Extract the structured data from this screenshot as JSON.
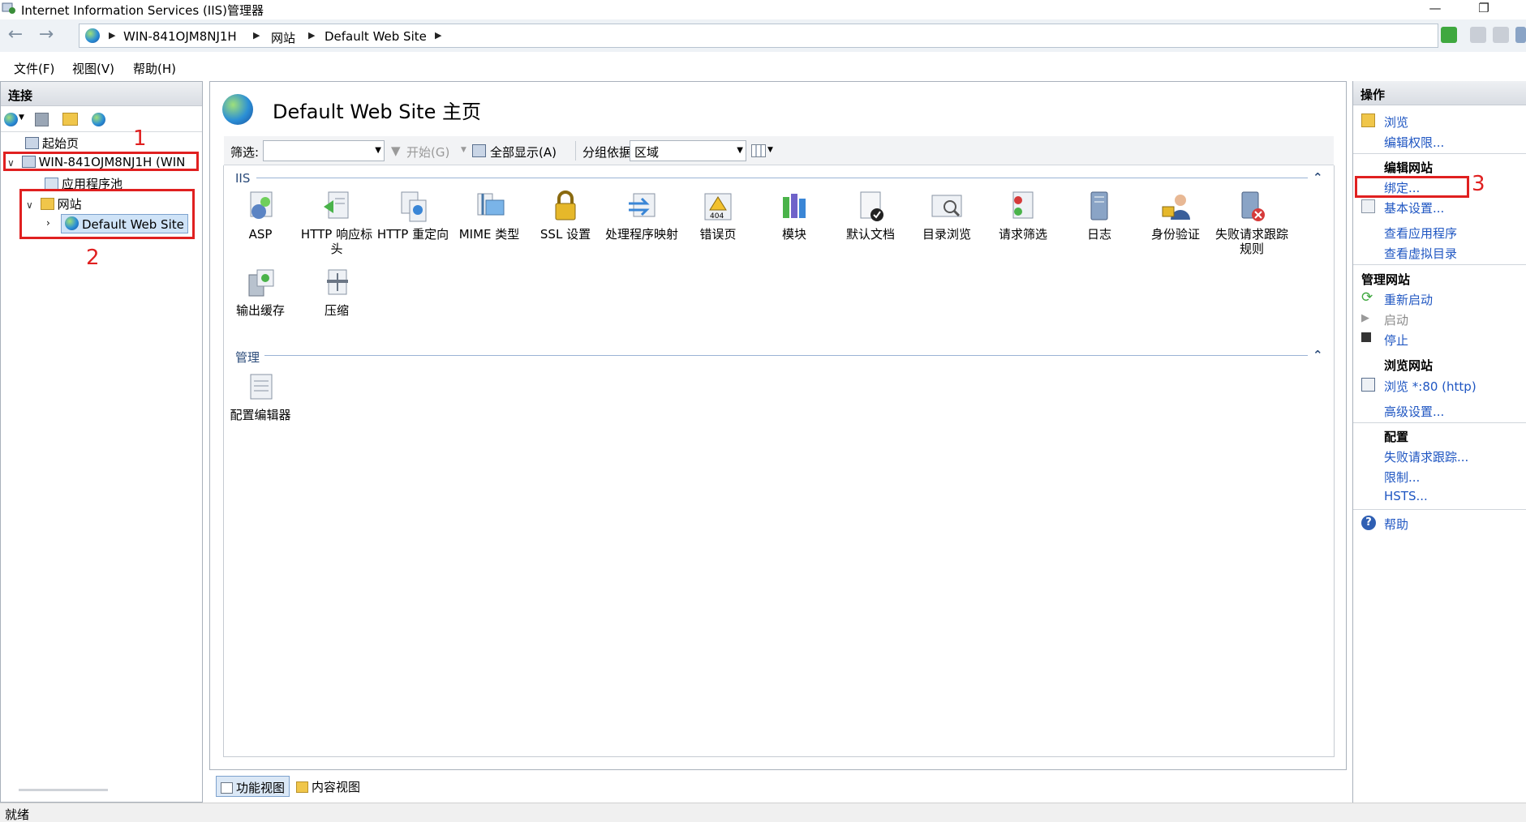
{
  "window": {
    "title": "Internet Information Services (IIS)管理器",
    "minimize": "—",
    "restore": "❐"
  },
  "nav": {
    "back": "←",
    "forward": "→"
  },
  "breadcrumb": [
    "WIN-841OJM8NJ1H",
    "网站",
    "Default Web Site"
  ],
  "menu": [
    "文件(F)",
    "视图(V)",
    "帮助(H)"
  ],
  "connections": {
    "title": "连接",
    "tree": [
      {
        "label": "起始页"
      },
      {
        "label": "WIN-841OJM8NJ1H (WIN"
      },
      {
        "label": "应用程序池"
      },
      {
        "label": "网站"
      },
      {
        "label": "Default Web Site"
      }
    ]
  },
  "main": {
    "title": "Default Web Site 主页",
    "filter": {
      "label": "筛选:",
      "start": "开始(G)",
      "show_all": "全部显示(A)",
      "group_by_label": "分组依据:",
      "group_by_value": "区域"
    },
    "groups": {
      "iis": {
        "name": "IIS",
        "features": [
          "ASP",
          "HTTP 响应标头",
          "HTTP 重定向",
          "MIME 类型",
          "SSL 设置",
          "处理程序映射",
          "错误页",
          "模块",
          "默认文档",
          "目录浏览",
          "请求筛选",
          "日志",
          "身份验证",
          "失败请求跟踪规则",
          "输出缓存",
          "压缩"
        ]
      },
      "manage": {
        "name": "管理",
        "features": [
          "配置编辑器"
        ]
      }
    },
    "view_tabs": [
      "功能视图",
      "内容视图"
    ]
  },
  "actions": {
    "title": "操作",
    "explore": "浏览",
    "edit_permissions": "编辑权限...",
    "edit_site_header": "编辑网站",
    "bindings": "绑定...",
    "basic_settings": "基本设置...",
    "view_apps": "查看应用程序",
    "view_vdirs": "查看虚拟目录",
    "manage_site_header": "管理网站",
    "restart": "重新启动",
    "start": "启动",
    "stop": "停止",
    "browse_site_header": "浏览网站",
    "browse_80": "浏览 *:80 (http)",
    "advanced_settings": "高级设置...",
    "config_header": "配置",
    "failed_request_tracing": "失败请求跟踪...",
    "limits": "限制...",
    "hsts": "HSTS...",
    "help": "帮助"
  },
  "annotations": [
    "1",
    "2",
    "3"
  ],
  "status": "就绪",
  "colors": {
    "link": "#1f56c2",
    "annotation": "#e02020",
    "group_text": "#2b4b7a"
  }
}
